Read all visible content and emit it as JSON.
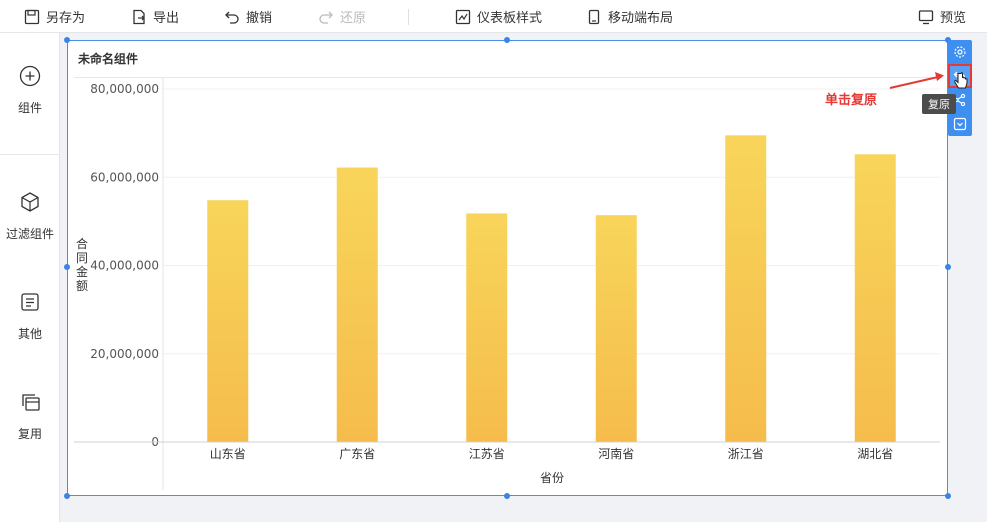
{
  "toolbar": {
    "save_as": "另存为",
    "export": "导出",
    "undo": "撤销",
    "redo": "还原",
    "dashboard_style": "仪表板样式",
    "mobile_layout": "移动端布局",
    "preview": "预览"
  },
  "sidebar": {
    "items": [
      {
        "label": "组件",
        "icon": "plus-circle-icon"
      },
      {
        "label": "过滤组件",
        "icon": "cube-icon"
      },
      {
        "label": "其他",
        "icon": "document-icon"
      },
      {
        "label": "复用",
        "icon": "copy-icon"
      }
    ]
  },
  "widget": {
    "title": "未命名组件",
    "tooltip": "复原",
    "annotation": "单击复原"
  },
  "colors": {
    "accent": "#3f8ff0",
    "bar_top": "#f8d55a",
    "bar_bottom": "#f5bc4c",
    "annotation": "#e53935"
  },
  "chart_data": {
    "type": "bar",
    "categories": [
      "山东省",
      "广东省",
      "江苏省",
      "河南省",
      "浙江省",
      "湖北省"
    ],
    "values": [
      54800000,
      62200000,
      51800000,
      51400000,
      69500000,
      65200000
    ],
    "ylim": [
      0,
      80000000
    ],
    "yticks": [
      "0",
      "20,000,000",
      "40,000,000",
      "60,000,000",
      "80,000,000"
    ],
    "xlabel": "省份",
    "ylabel": "合同金额",
    "grid": true
  }
}
